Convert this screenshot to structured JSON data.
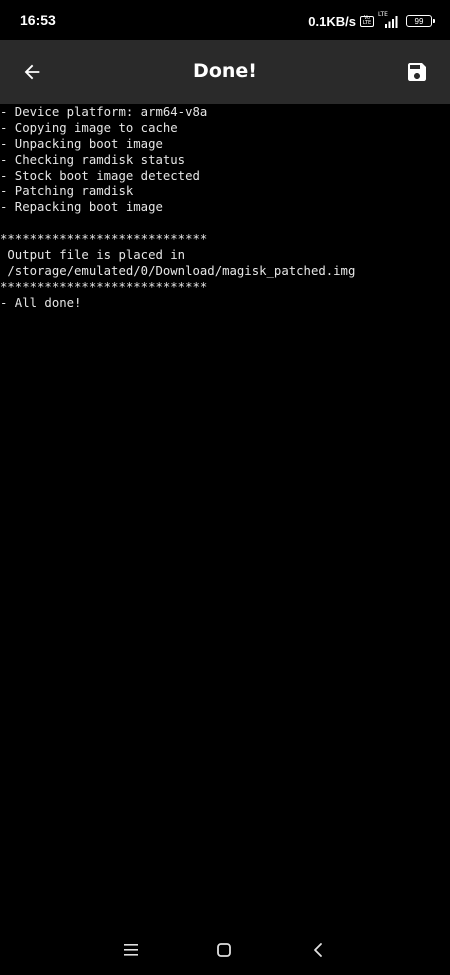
{
  "status_bar": {
    "time": "16:53",
    "net_speed": "0.1KB/s",
    "volte_label": "Vo LTE",
    "signal_label": "LTE",
    "battery": "99"
  },
  "toolbar": {
    "title": "Done!",
    "back_icon": "arrow-left-icon",
    "save_icon": "save-icon"
  },
  "console": {
    "lines": [
      "- Device platform: arm64-v8a",
      "- Copying image to cache",
      "- Unpacking boot image",
      "- Checking ramdisk status",
      "- Stock boot image detected",
      "- Patching ramdisk",
      "- Repacking boot image",
      "",
      "****************************",
      " Output file is placed in",
      " /storage/emulated/0/Download/magisk_patched.img",
      "****************************",
      "- All done!"
    ]
  },
  "nav_bar": {
    "menu_icon": "menu-icon",
    "home_icon": "home-icon",
    "back_icon": "chevron-left-icon"
  }
}
